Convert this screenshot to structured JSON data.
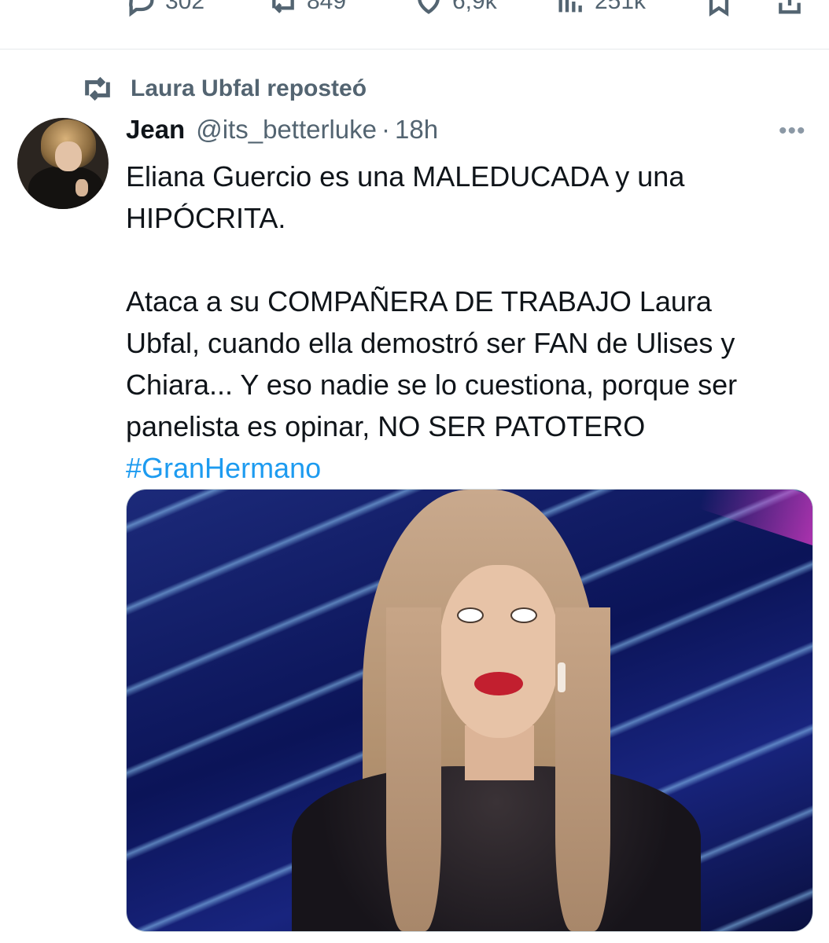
{
  "prev_tweet_actions": {
    "replies": "302",
    "reposts": "849",
    "likes": "6,9k",
    "views": "251k"
  },
  "repost_banner": {
    "text": "Laura Ubfal reposteó"
  },
  "tweet": {
    "author_name": "Jean",
    "author_handle": "@its_betterluke",
    "separator": "·",
    "time": "18h",
    "more": "•••",
    "text_para1_line1": "Eliana Guercio es una MALEDUCADA y una",
    "text_para1_line2": "HIPÓCRITA.",
    "text_para2_line1": "Ataca a su COMPAÑERA DE TRABAJO Laura",
    "text_para2_line2": "Ubfal, cuando ella demostró ser FAN de Ulises y",
    "text_para2_line3": "Chiara... Y eso nadie se lo cuestiona, porque ser",
    "text_para2_line4": "panelista es opinar, NO SER PATOTERO",
    "hashtag": "#GranHermano"
  },
  "colors": {
    "accent": "#1d9bf0",
    "secondary_text": "#536471",
    "primary_text": "#0f1419"
  },
  "icons": [
    "reply-icon",
    "repost-icon",
    "like-icon",
    "views-icon",
    "bookmark-icon",
    "share-icon",
    "more-icon"
  ]
}
